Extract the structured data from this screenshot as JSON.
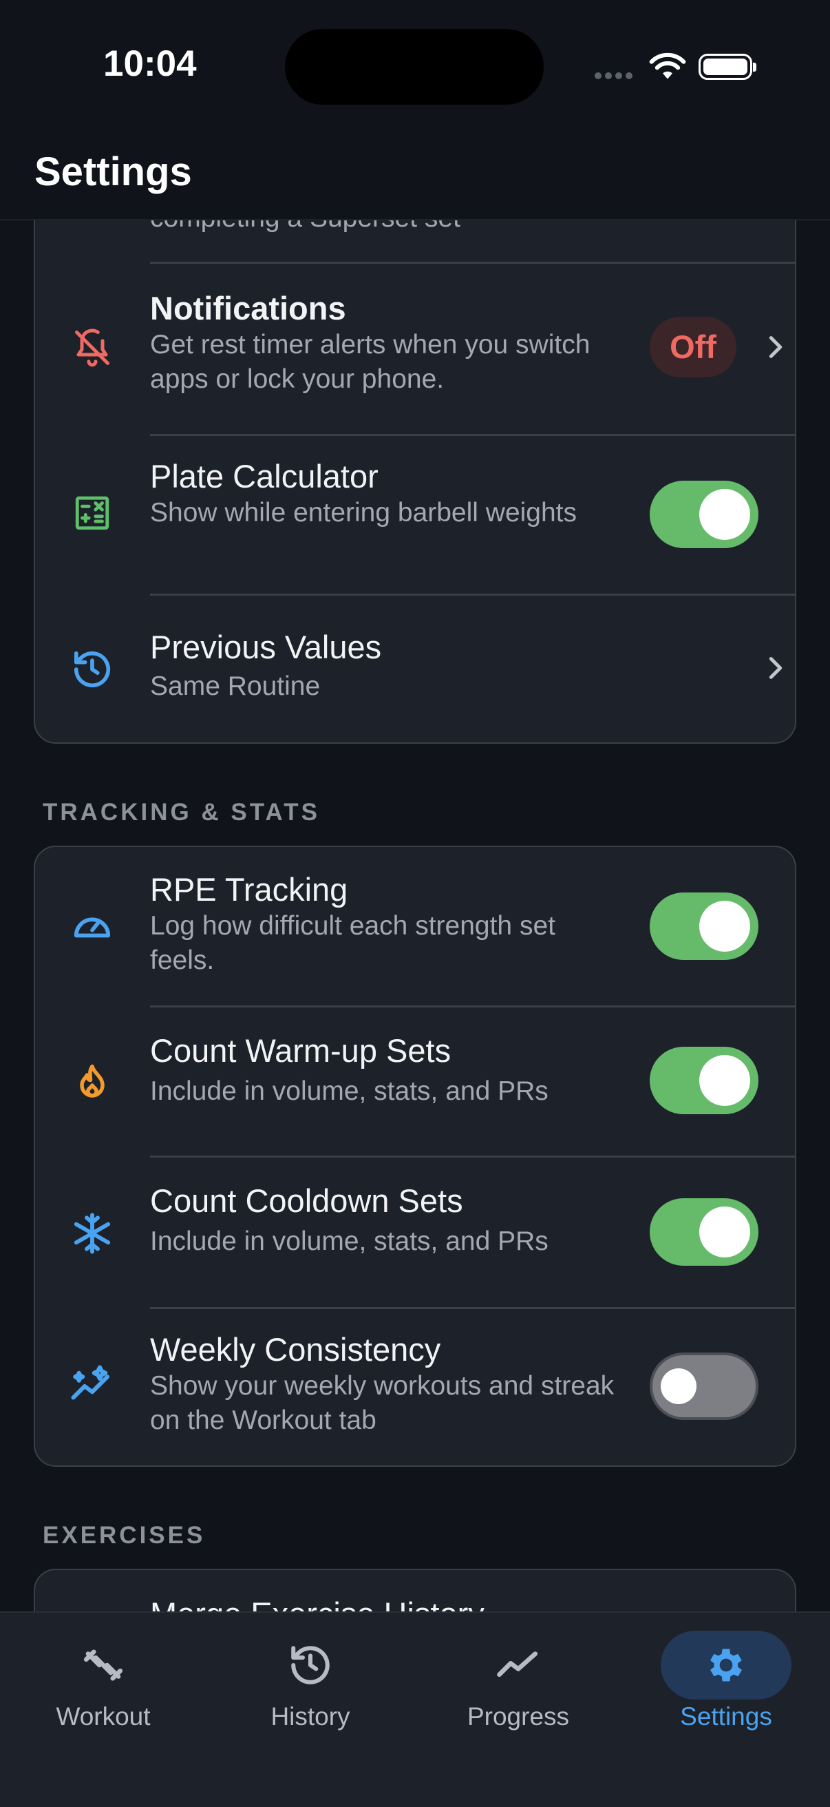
{
  "status_bar": {
    "time": "10:04"
  },
  "header": {
    "title": "Settings"
  },
  "partial_top_row": {
    "subtitle": "completing a Superset set"
  },
  "workout_group": {
    "notifications": {
      "title": "Notifications",
      "subtitle": "Get rest timer alerts when you switch apps or lock your phone.",
      "badge": "Off",
      "icon": "bell-off-icon",
      "icon_color": "#ef6a62"
    },
    "plate_calculator": {
      "title": "Plate Calculator",
      "subtitle": "Show while entering barbell weights",
      "enabled": true,
      "icon": "calculator-icon",
      "icon_color": "#5fbf6a"
    },
    "previous_values": {
      "title": "Previous Values",
      "subtitle": "Same Routine",
      "icon": "history-icon",
      "icon_color": "#4aa3f0"
    }
  },
  "tracking_section": {
    "label": "TRACKING & STATS",
    "rpe_tracking": {
      "title": "RPE Tracking",
      "subtitle": "Log how difficult each strength set feels.",
      "enabled": true,
      "icon": "gauge-icon",
      "icon_color": "#4aa3f0"
    },
    "count_warmup": {
      "title": "Count Warm-up Sets",
      "subtitle": "Include in volume, stats, and PRs",
      "enabled": true,
      "icon": "flame-icon",
      "icon_color": "#f39a2b"
    },
    "count_cooldown": {
      "title": "Count Cooldown Sets",
      "subtitle": "Include in volume, stats, and PRs",
      "enabled": true,
      "icon": "snowflake-icon",
      "icon_color": "#4aa3f0"
    },
    "weekly_consistency": {
      "title": "Weekly Consistency",
      "subtitle": "Show your weekly workouts and streak on the Workout tab",
      "enabled": false,
      "icon": "trend-sparkle-icon",
      "icon_color": "#4aa3f0"
    }
  },
  "exercises_section": {
    "label": "EXERCISES",
    "merge_history": {
      "title": "Merge Exercise History"
    }
  },
  "tabbar": {
    "tabs": [
      {
        "label": "Workout",
        "icon": "dumbbell-icon",
        "active": false
      },
      {
        "label": "History",
        "icon": "history-icon",
        "active": false
      },
      {
        "label": "Progress",
        "icon": "trend-icon",
        "active": false
      },
      {
        "label": "Settings",
        "icon": "gear-icon",
        "active": true
      }
    ]
  },
  "colors": {
    "accent": "#4aa3f0",
    "toggle_on": "#66bb6a",
    "background": "#10131a",
    "card": "#1d212a"
  }
}
